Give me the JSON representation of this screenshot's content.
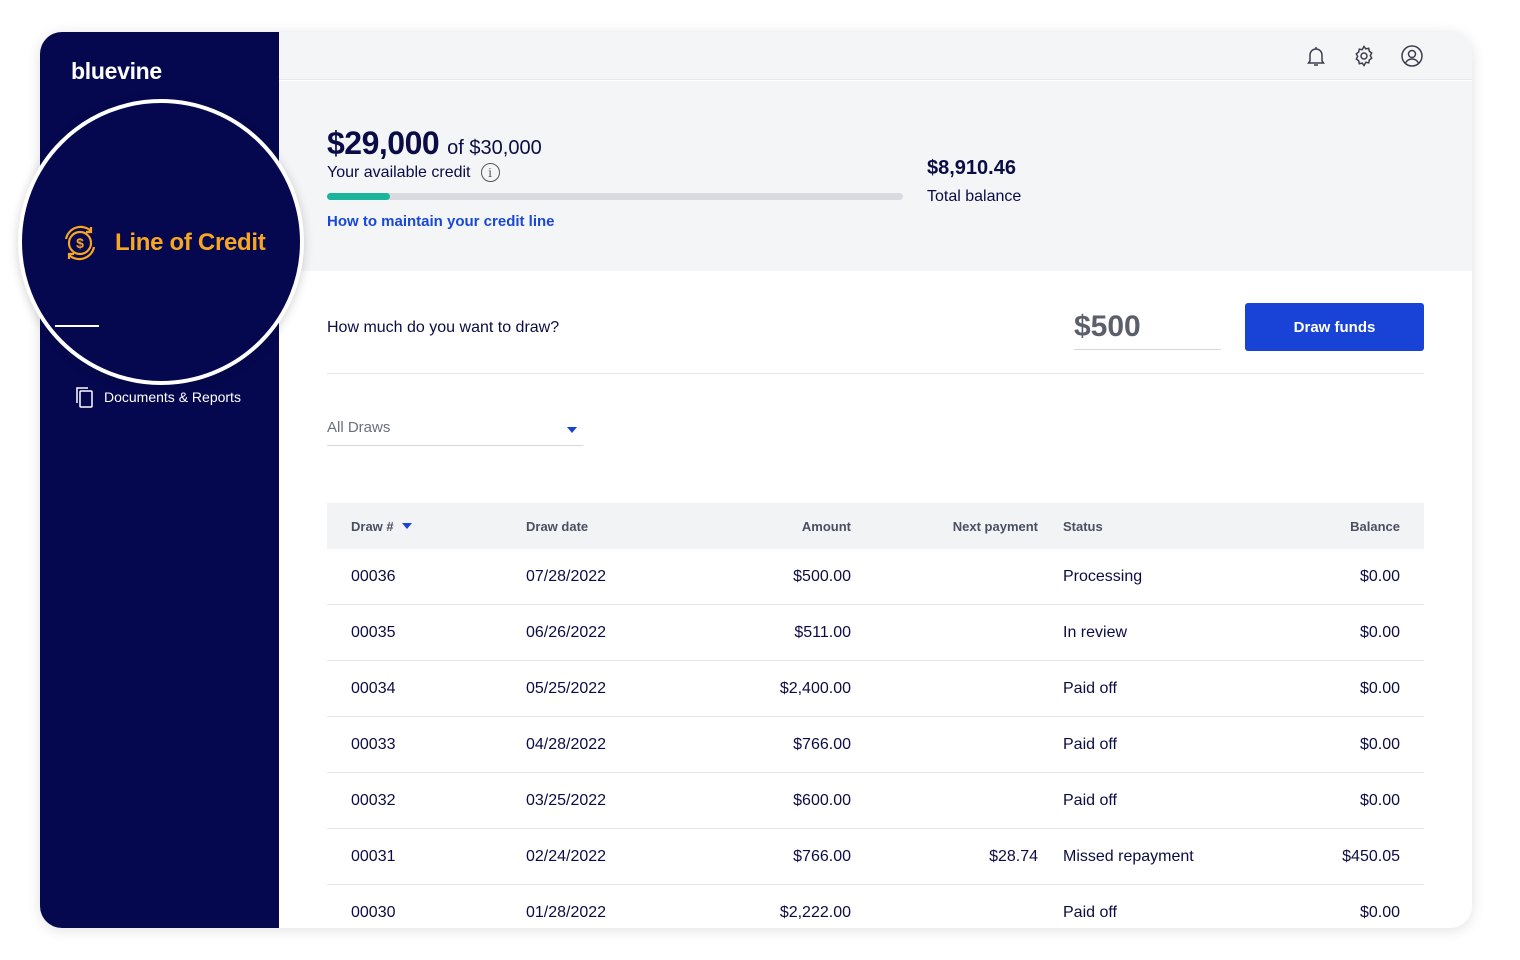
{
  "brand": {
    "logo_text": "bluevine",
    "accent": "#f6a623",
    "primary": "#1943d6",
    "navy": "#05084f"
  },
  "sidebar": {
    "active_item": {
      "label": "Line of Credit",
      "icon": "dollar-refresh-icon"
    },
    "items": [
      {
        "label": "Documents & Reports",
        "icon": "documents-icon"
      }
    ]
  },
  "topbar": {
    "icons": [
      "bell-icon",
      "gear-icon",
      "user-circle-icon"
    ]
  },
  "summary": {
    "available_credit": "$29,000",
    "credit_limit": "of $30,000",
    "available_label": "Your available credit",
    "usage_fraction": 0.11,
    "maintain_link": "How to maintain your credit line",
    "total_balance": "$8,910.46",
    "total_balance_label": "Total balance"
  },
  "draw": {
    "question": "How much do you want to draw?",
    "amount_value": "$500",
    "button_label": "Draw funds"
  },
  "filter": {
    "selected": "All Draws"
  },
  "table": {
    "headers": {
      "draw": "Draw #",
      "date": "Draw date",
      "amount": "Amount",
      "next": "Next payment",
      "status": "Status",
      "balance": "Balance"
    },
    "rows": [
      {
        "draw": "00036",
        "date": "07/28/2022",
        "amount": "$500.00",
        "next": "",
        "status": "Processing",
        "balance": "$0.00"
      },
      {
        "draw": "00035",
        "date": "06/26/2022",
        "amount": "$511.00",
        "next": "",
        "status": "In review",
        "balance": "$0.00"
      },
      {
        "draw": "00034",
        "date": "05/25/2022",
        "amount": "$2,400.00",
        "next": "",
        "status": "Paid off",
        "balance": "$0.00"
      },
      {
        "draw": "00033",
        "date": "04/28/2022",
        "amount": "$766.00",
        "next": "",
        "status": "Paid off",
        "balance": "$0.00"
      },
      {
        "draw": "00032",
        "date": "03/25/2022",
        "amount": "$600.00",
        "next": "",
        "status": "Paid off",
        "balance": "$0.00"
      },
      {
        "draw": "00031",
        "date": "02/24/2022",
        "amount": "$766.00",
        "next": "$28.74",
        "status": "Missed repayment",
        "balance": "$450.05"
      },
      {
        "draw": "00030",
        "date": "01/28/2022",
        "amount": "$2,222.00",
        "next": "",
        "status": "Paid off",
        "balance": "$0.00"
      }
    ]
  }
}
